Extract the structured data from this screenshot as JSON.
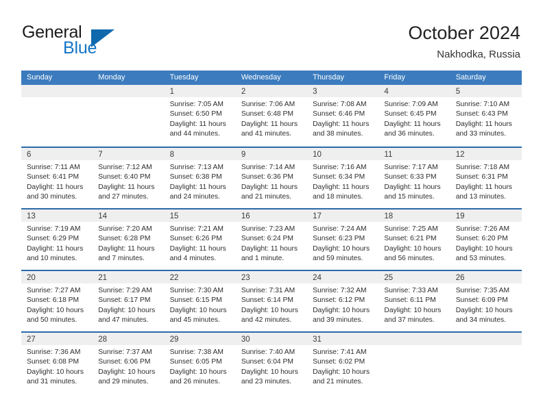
{
  "brand": {
    "name_part1": "General",
    "name_part2": "Blue",
    "triangle_color": "#1068ad",
    "blue_color": "#1374c6"
  },
  "header": {
    "title": "October 2024",
    "location": "Nakhodka, Russia"
  },
  "theme": {
    "header_row_bg": "#3c7cbe",
    "row_separator": "#2b6aab",
    "day_band_bg": "#efefef"
  },
  "weekdays": [
    "Sunday",
    "Monday",
    "Tuesday",
    "Wednesday",
    "Thursday",
    "Friday",
    "Saturday"
  ],
  "weeks": [
    [
      {
        "day": "",
        "lines": []
      },
      {
        "day": "",
        "lines": []
      },
      {
        "day": "1",
        "lines": [
          "Sunrise: 7:05 AM",
          "Sunset: 6:50 PM",
          "Daylight: 11 hours",
          "and 44 minutes."
        ]
      },
      {
        "day": "2",
        "lines": [
          "Sunrise: 7:06 AM",
          "Sunset: 6:48 PM",
          "Daylight: 11 hours",
          "and 41 minutes."
        ]
      },
      {
        "day": "3",
        "lines": [
          "Sunrise: 7:08 AM",
          "Sunset: 6:46 PM",
          "Daylight: 11 hours",
          "and 38 minutes."
        ]
      },
      {
        "day": "4",
        "lines": [
          "Sunrise: 7:09 AM",
          "Sunset: 6:45 PM",
          "Daylight: 11 hours",
          "and 36 minutes."
        ]
      },
      {
        "day": "5",
        "lines": [
          "Sunrise: 7:10 AM",
          "Sunset: 6:43 PM",
          "Daylight: 11 hours",
          "and 33 minutes."
        ]
      }
    ],
    [
      {
        "day": "6",
        "lines": [
          "Sunrise: 7:11 AM",
          "Sunset: 6:41 PM",
          "Daylight: 11 hours",
          "and 30 minutes."
        ]
      },
      {
        "day": "7",
        "lines": [
          "Sunrise: 7:12 AM",
          "Sunset: 6:40 PM",
          "Daylight: 11 hours",
          "and 27 minutes."
        ]
      },
      {
        "day": "8",
        "lines": [
          "Sunrise: 7:13 AM",
          "Sunset: 6:38 PM",
          "Daylight: 11 hours",
          "and 24 minutes."
        ]
      },
      {
        "day": "9",
        "lines": [
          "Sunrise: 7:14 AM",
          "Sunset: 6:36 PM",
          "Daylight: 11 hours",
          "and 21 minutes."
        ]
      },
      {
        "day": "10",
        "lines": [
          "Sunrise: 7:16 AM",
          "Sunset: 6:34 PM",
          "Daylight: 11 hours",
          "and 18 minutes."
        ]
      },
      {
        "day": "11",
        "lines": [
          "Sunrise: 7:17 AM",
          "Sunset: 6:33 PM",
          "Daylight: 11 hours",
          "and 15 minutes."
        ]
      },
      {
        "day": "12",
        "lines": [
          "Sunrise: 7:18 AM",
          "Sunset: 6:31 PM",
          "Daylight: 11 hours",
          "and 13 minutes."
        ]
      }
    ],
    [
      {
        "day": "13",
        "lines": [
          "Sunrise: 7:19 AM",
          "Sunset: 6:29 PM",
          "Daylight: 11 hours",
          "and 10 minutes."
        ]
      },
      {
        "day": "14",
        "lines": [
          "Sunrise: 7:20 AM",
          "Sunset: 6:28 PM",
          "Daylight: 11 hours",
          "and 7 minutes."
        ]
      },
      {
        "day": "15",
        "lines": [
          "Sunrise: 7:21 AM",
          "Sunset: 6:26 PM",
          "Daylight: 11 hours",
          "and 4 minutes."
        ]
      },
      {
        "day": "16",
        "lines": [
          "Sunrise: 7:23 AM",
          "Sunset: 6:24 PM",
          "Daylight: 11 hours",
          "and 1 minute."
        ]
      },
      {
        "day": "17",
        "lines": [
          "Sunrise: 7:24 AM",
          "Sunset: 6:23 PM",
          "Daylight: 10 hours",
          "and 59 minutes."
        ]
      },
      {
        "day": "18",
        "lines": [
          "Sunrise: 7:25 AM",
          "Sunset: 6:21 PM",
          "Daylight: 10 hours",
          "and 56 minutes."
        ]
      },
      {
        "day": "19",
        "lines": [
          "Sunrise: 7:26 AM",
          "Sunset: 6:20 PM",
          "Daylight: 10 hours",
          "and 53 minutes."
        ]
      }
    ],
    [
      {
        "day": "20",
        "lines": [
          "Sunrise: 7:27 AM",
          "Sunset: 6:18 PM",
          "Daylight: 10 hours",
          "and 50 minutes."
        ]
      },
      {
        "day": "21",
        "lines": [
          "Sunrise: 7:29 AM",
          "Sunset: 6:17 PM",
          "Daylight: 10 hours",
          "and 47 minutes."
        ]
      },
      {
        "day": "22",
        "lines": [
          "Sunrise: 7:30 AM",
          "Sunset: 6:15 PM",
          "Daylight: 10 hours",
          "and 45 minutes."
        ]
      },
      {
        "day": "23",
        "lines": [
          "Sunrise: 7:31 AM",
          "Sunset: 6:14 PM",
          "Daylight: 10 hours",
          "and 42 minutes."
        ]
      },
      {
        "day": "24",
        "lines": [
          "Sunrise: 7:32 AM",
          "Sunset: 6:12 PM",
          "Daylight: 10 hours",
          "and 39 minutes."
        ]
      },
      {
        "day": "25",
        "lines": [
          "Sunrise: 7:33 AM",
          "Sunset: 6:11 PM",
          "Daylight: 10 hours",
          "and 37 minutes."
        ]
      },
      {
        "day": "26",
        "lines": [
          "Sunrise: 7:35 AM",
          "Sunset: 6:09 PM",
          "Daylight: 10 hours",
          "and 34 minutes."
        ]
      }
    ],
    [
      {
        "day": "27",
        "lines": [
          "Sunrise: 7:36 AM",
          "Sunset: 6:08 PM",
          "Daylight: 10 hours",
          "and 31 minutes."
        ]
      },
      {
        "day": "28",
        "lines": [
          "Sunrise: 7:37 AM",
          "Sunset: 6:06 PM",
          "Daylight: 10 hours",
          "and 29 minutes."
        ]
      },
      {
        "day": "29",
        "lines": [
          "Sunrise: 7:38 AM",
          "Sunset: 6:05 PM",
          "Daylight: 10 hours",
          "and 26 minutes."
        ]
      },
      {
        "day": "30",
        "lines": [
          "Sunrise: 7:40 AM",
          "Sunset: 6:04 PM",
          "Daylight: 10 hours",
          "and 23 minutes."
        ]
      },
      {
        "day": "31",
        "lines": [
          "Sunrise: 7:41 AM",
          "Sunset: 6:02 PM",
          "Daylight: 10 hours",
          "and 21 minutes."
        ]
      },
      {
        "day": "",
        "lines": []
      },
      {
        "day": "",
        "lines": []
      }
    ]
  ]
}
